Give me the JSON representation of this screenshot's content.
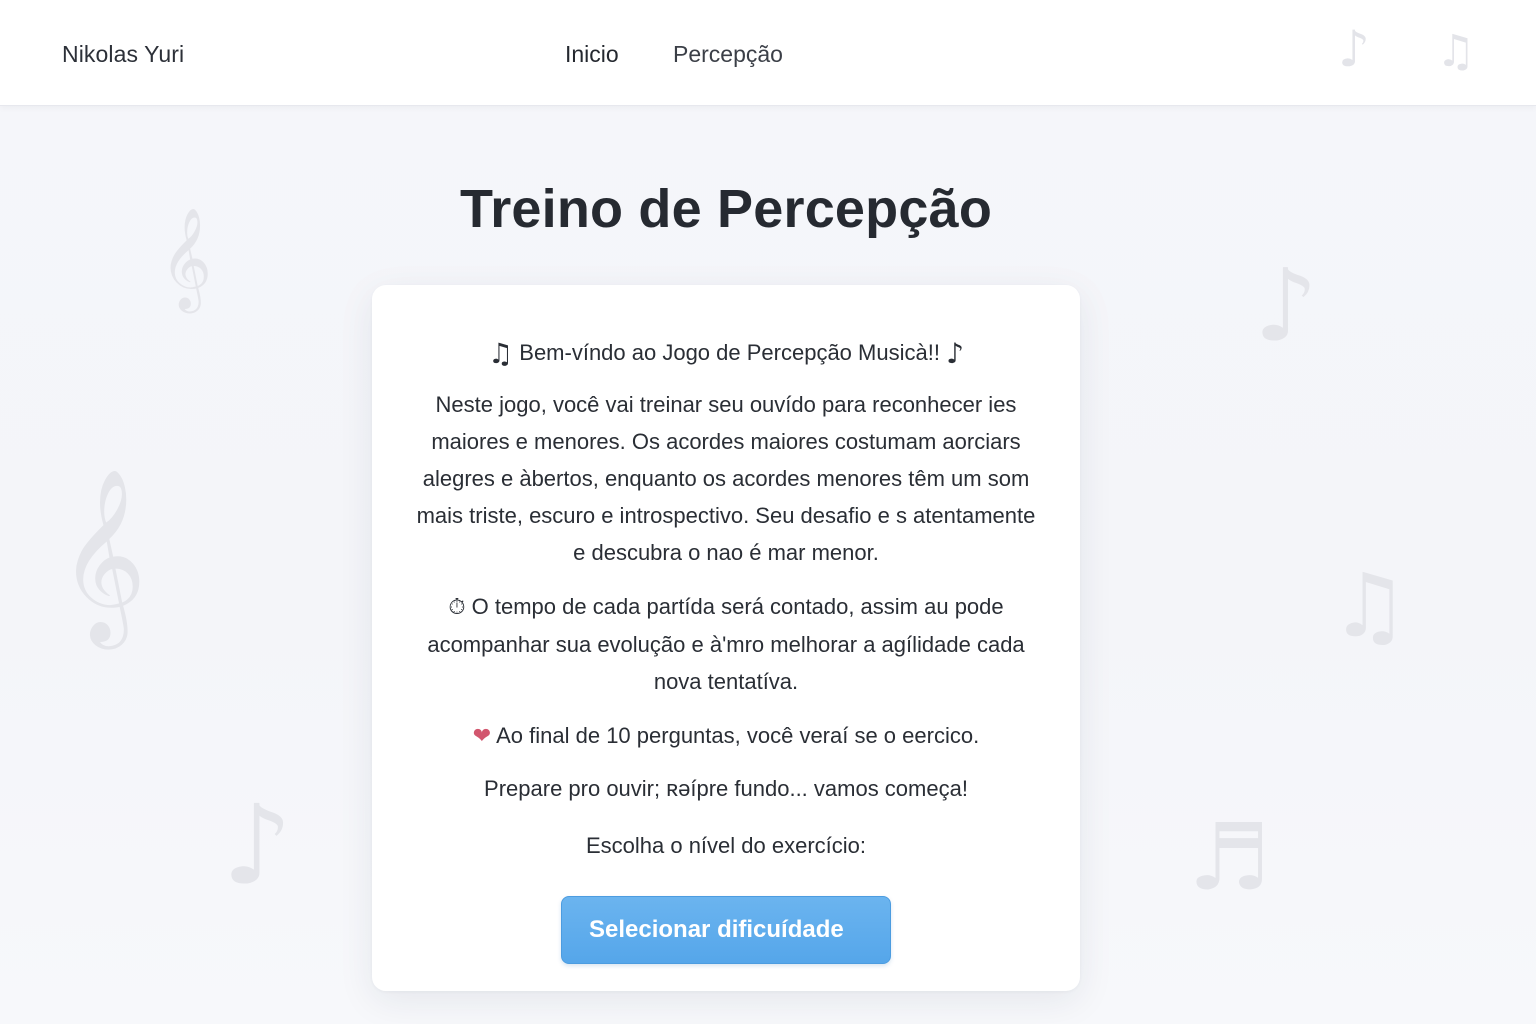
{
  "header": {
    "brand": "Nikolas Yuri",
    "nav": [
      {
        "label": "Inicio"
      },
      {
        "label": "Percepção"
      }
    ],
    "decor_icons": [
      "eighth-note-icon",
      "beamed-notes-icon"
    ]
  },
  "main": {
    "title": "Treino de Percepção",
    "card": {
      "welcome": {
        "icon_left": "♫",
        "text": "Bem-víndo ao Jogo de Percepção Musicà!!",
        "icon_right": "♪"
      },
      "paragraph_1": "Neste jogo, você vai treinar seu ouvído para reconhecer ies maiores e menores. Os acordes maiores costumam aorciars alegres e àbertos, enquanto os acordes menores têm um som mais triste, escuro e introspectivo. Seu desafio e s atentamente e descubra o nao é mar menor.",
      "paragraph_2_icon": "⏱",
      "paragraph_2": "O tempo de cada partída será contado, assim au pode acompanhar sua evolução e à'mro melhorar a agílidade cada nova tentatíva.",
      "paragraph_3_icon": "❤",
      "paragraph_3": "Ao final de 10 perguntas, você veraí se o eercico.",
      "paragraph_4": "Prepare pro ouvir; ʀəípre fundo... vamos começa!",
      "level_label": "Escolha o nível do exercício:",
      "button_label": "Selecionar dificuídade"
    }
  },
  "background_icons": [
    "treble-clef-icon",
    "treble-clef-icon",
    "eighth-note-icon",
    "eighth-note-icon",
    "beamed-notes-icon",
    "beamed-sixteenth-icon"
  ],
  "colors": {
    "accent": "#5aa9eb",
    "background": "#f4f5f9",
    "card": "#ffffff",
    "text": "#2a2e35"
  }
}
